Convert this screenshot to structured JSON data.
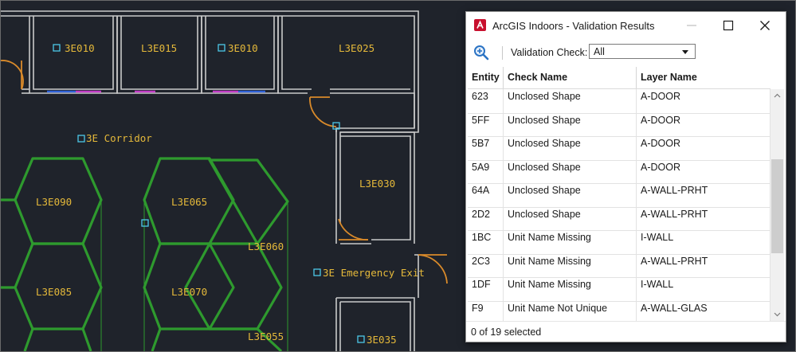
{
  "floorplan": {
    "rooms": [
      {
        "id": "3e010-a",
        "label": "3E010",
        "marker": true
      },
      {
        "id": "l3e015",
        "label": "L3E015",
        "marker": false
      },
      {
        "id": "3e010-b",
        "label": "3E010",
        "marker": true
      },
      {
        "id": "l3e025",
        "label": "L3E025",
        "marker": false
      },
      {
        "id": "3e-corridor",
        "label": "3E Corridor",
        "marker": true
      },
      {
        "id": "l3e030",
        "label": "L3E030",
        "marker": false
      },
      {
        "id": "l3e090",
        "label": "L3E090",
        "marker": false
      },
      {
        "id": "l3e065",
        "label": "L3E065",
        "marker": false
      },
      {
        "id": "l3e060",
        "label": "L3E060",
        "marker": false
      },
      {
        "id": "3e-emergency-exit",
        "label": "3E Emergency Exit",
        "marker": true
      },
      {
        "id": "l3e085",
        "label": "L3E085",
        "marker": false
      },
      {
        "id": "l3e070",
        "label": "L3E070",
        "marker": false
      },
      {
        "id": "l3e055",
        "label": "L3E055",
        "marker": false
      },
      {
        "id": "3e035",
        "label": "3E035",
        "marker": true
      }
    ],
    "colors": {
      "label": "#e5b93a",
      "wall": "#c9c9c9",
      "hex_wall": "#2e9a2e",
      "door": "#d98a2a",
      "marker": "#4cc8e8",
      "window_blue": "#2f62d8",
      "window_magenta": "#c23cc6"
    }
  },
  "dialog": {
    "title": "ArcGIS Indoors - Validation Results",
    "toolbar": {
      "zoom_icon": "zoom-in-icon",
      "validation_check_label": "Validation Check:",
      "validation_check_value": "All"
    },
    "table": {
      "columns": [
        "Entity",
        "Check Name",
        "Layer Name"
      ],
      "rows": [
        {
          "entity": "623",
          "check": "Unclosed Shape",
          "layer": "A-DOOR"
        },
        {
          "entity": "5FF",
          "check": "Unclosed Shape",
          "layer": "A-DOOR"
        },
        {
          "entity": "5B7",
          "check": "Unclosed Shape",
          "layer": "A-DOOR"
        },
        {
          "entity": "5A9",
          "check": "Unclosed Shape",
          "layer": "A-DOOR"
        },
        {
          "entity": "64A",
          "check": "Unclosed Shape",
          "layer": "A-WALL-PRHT"
        },
        {
          "entity": "2D2",
          "check": "Unclosed Shape",
          "layer": "A-WALL-PRHT"
        },
        {
          "entity": "1BC",
          "check": "Unit Name Missing",
          "layer": "I-WALL"
        },
        {
          "entity": "2C3",
          "check": "Unit Name Missing",
          "layer": "A-WALL-PRHT"
        },
        {
          "entity": "1DF",
          "check": "Unit Name Missing",
          "layer": "I-WALL"
        },
        {
          "entity": "F9",
          "check": "Unit Name Not Unique",
          "layer": "A-WALL-GLAS"
        }
      ]
    },
    "status": "0 of 19 selected",
    "colors": {
      "app_icon": "#c8102e",
      "zoom_icon": "#2b73c4"
    }
  }
}
